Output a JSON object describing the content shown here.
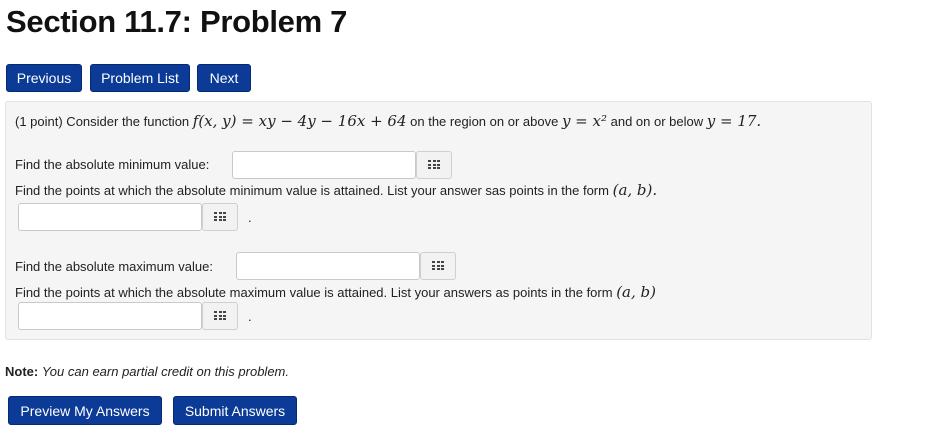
{
  "page": {
    "title": "Section 11.7: Problem 7"
  },
  "nav": {
    "previous": "Previous",
    "problem_list": "Problem List",
    "next": "Next"
  },
  "problem": {
    "points": "(1 point) Consider the function",
    "function_expr": "f(x, y) = xy − 4y − 16x + 64",
    "region_text_1": "on the region on or above",
    "region_expr_1": "y = x²",
    "region_text_2": "and on or below",
    "region_expr_2": "y = 17.",
    "q1_label": "Find the absolute minimum value:",
    "q1_value": "",
    "q2_label": "Find the points at which the absolute minimum value is attained. List your answer sas points in the form",
    "q2_form": "(a, b).",
    "q2_value": "",
    "q3_label": "Find the absolute maximum value:",
    "q3_value": "",
    "q4_label": "Find the points at which the absolute maximum value is attained. List your answers as points in the form",
    "q4_form": "(a, b)",
    "q4_value": "",
    "trailing_period": "."
  },
  "note": {
    "label": "Note:",
    "text": "You can earn partial credit on this problem."
  },
  "actions": {
    "preview": "Preview My Answers",
    "submit": "Submit Answers"
  },
  "icons": {
    "matrix": "matrix-grid-icon"
  },
  "colors": {
    "button_bg": "#0b3a97",
    "panel_bg": "#f5f5f5"
  }
}
